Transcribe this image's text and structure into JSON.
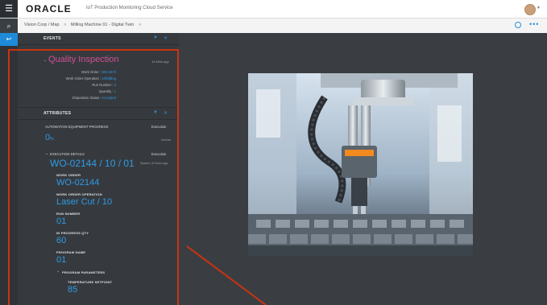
{
  "header": {
    "logo_text": "ORACLE",
    "app_title": "IoT Production Monitoring Cloud Service",
    "menu_icon": "hamburger-icon",
    "avatar_icon": "user-avatar-icon"
  },
  "breadcrumb": {
    "items": [
      "Vision Corp / Map",
      "Milling Machine 01 - Digital Twin"
    ],
    "separator": ">"
  },
  "events": {
    "header": "EVENTS",
    "title": "Quality Inspection",
    "time_ago": "14 Mins ago",
    "fields": [
      {
        "label": "Work Order :",
        "value": "WO-2573"
      },
      {
        "label": "Work Order Operation :",
        "value": "10/Milling"
      },
      {
        "label": "Run Number :",
        "value": "3"
      },
      {
        "label": "Quantity :",
        "value": "1"
      },
      {
        "label": "Disposition Status :",
        "value": "Accepted"
      }
    ]
  },
  "attributes": {
    "header": "ATTRIBUTES",
    "automation_label": "AUTOMATION EQUIPMENT PROGRESS",
    "automation_status": "Execution",
    "automation_value": "0",
    "automation_unit": "%",
    "automation_note": "Normal",
    "exec_label": "EXECUTION DETAILS",
    "exec_status": "Execution",
    "exec_value": "WO-02144 / 10 / 01",
    "exec_meta": "System | 8 Hours ago",
    "work_order_label": "WORK ORDER",
    "work_order_value": "WO-02144",
    "operation_label": "WORK ORDER OPERATION",
    "operation_value": "Laser Cut / 10",
    "run_label": "RUN NUMBER",
    "run_value": "01",
    "inprogress_label": "IN PROGRESS QTY",
    "inprogress_value": "60",
    "program_label": "PROGRAM NAME",
    "program_value": "01",
    "params_label": "PROGRAM PARAMETERS",
    "temp_label": "TEMPERATURE SETPOINT",
    "temp_value": "85"
  },
  "colors": {
    "accent": "#2f9ae6",
    "event_title": "#d04f96",
    "annotation": "#cc3311",
    "panel_bg": "#363a3e"
  }
}
